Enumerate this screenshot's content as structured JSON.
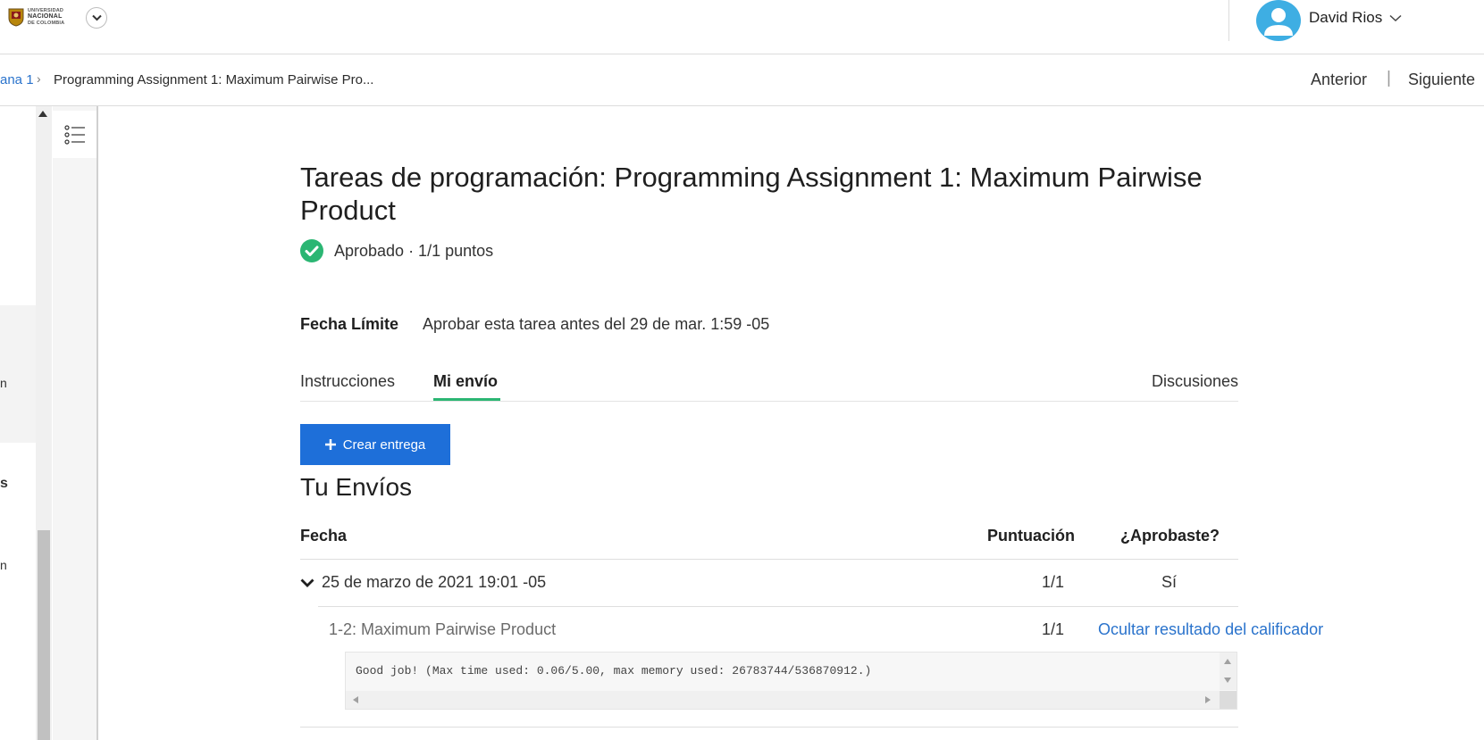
{
  "header": {
    "logo_text": [
      "UNIVERSIDAD",
      "NACIONAL",
      "DE COLOMBIA"
    ],
    "user_name": "David Rios"
  },
  "breadcrumb": {
    "prev": "ana 1",
    "current": "Programming Assignment 1: Maximum Pairwise Pro...",
    "nav_prev": "Anterior",
    "nav_sep": "|",
    "nav_next": "Siguiente"
  },
  "sidebar": {
    "fragments": [
      "n",
      "s",
      "n"
    ]
  },
  "main": {
    "title": "Tareas de programación: Programming Assignment 1: Maximum Pairwise Product",
    "status": "Aprobado · 1/1 puntos",
    "deadline_label": "Fecha Límite",
    "deadline_value": "Aprobar esta tarea antes del 29 de mar. 1:59 -05",
    "tabs": [
      {
        "label": "Instrucciones",
        "active": false
      },
      {
        "label": "Mi envío",
        "active": true
      },
      {
        "label": "Discusiones",
        "active": false
      }
    ],
    "create_button": "Crear entrega",
    "section_title": "Tu Envíos",
    "table": {
      "headers": [
        "Fecha",
        "Puntuación",
        "¿Aprobaste?"
      ],
      "submission": {
        "date": "25 de marzo de 2021 19:01 -05",
        "score": "1/1",
        "passed": "Sí"
      },
      "part": {
        "name": "1-2: Maximum Pairwise Product",
        "score": "1/1",
        "toggle_link": "Ocultar resultado del calificador"
      },
      "grader_output": "Good job! (Max time used: 0.06/5.00, max memory used: 26783744/536870912.)"
    }
  },
  "colors": {
    "accent_blue": "#1e6fd9",
    "link_blue": "#2a73cc",
    "success_green": "#2bb673",
    "avatar_blue": "#3eaee3"
  }
}
